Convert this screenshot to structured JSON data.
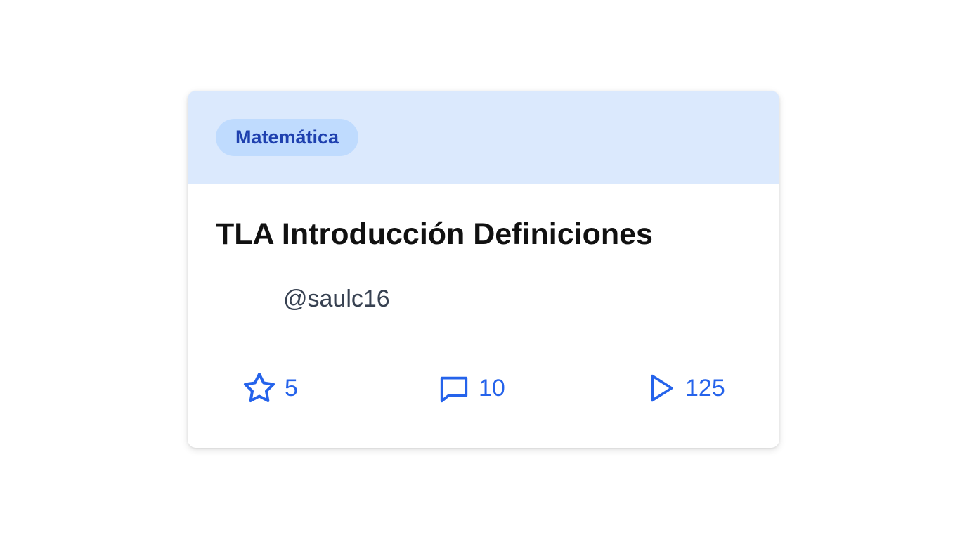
{
  "card": {
    "category": "Matemática",
    "title": "TLA Introducción Definiciones",
    "author": "@saulc16",
    "stats": {
      "stars": "5",
      "comments": "10",
      "plays": "125"
    },
    "icons": {
      "stars": "star-icon",
      "comments": "comment-icon",
      "plays": "play-icon"
    },
    "colors": {
      "header_bg": "#dbe9fd",
      "badge_bg": "#bfdbfe",
      "badge_text": "#1e40af",
      "accent": "#2563eb"
    }
  }
}
